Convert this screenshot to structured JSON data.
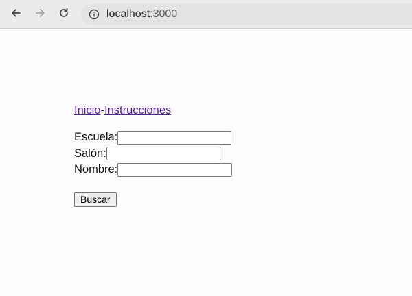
{
  "browser": {
    "url_host": "localhost",
    "url_port": ":3000",
    "icons": [
      "back-arrow-icon",
      "forward-arrow-icon",
      "reload-icon",
      "info-icon"
    ]
  },
  "nav": {
    "inicio": "Inicio",
    "separator": "-",
    "instrucciones": "Instrucciones"
  },
  "form": {
    "escuela_label": "Escuela:",
    "escuela_value": "",
    "salon_label": "Salón:",
    "salon_value": "",
    "nombre_label": "Nombre:",
    "nombre_value": "",
    "submit_label": "Buscar"
  },
  "colors": {
    "link": "#55208f",
    "page_bg": "#fefcfe",
    "toolbar_bg": "#ececec"
  }
}
